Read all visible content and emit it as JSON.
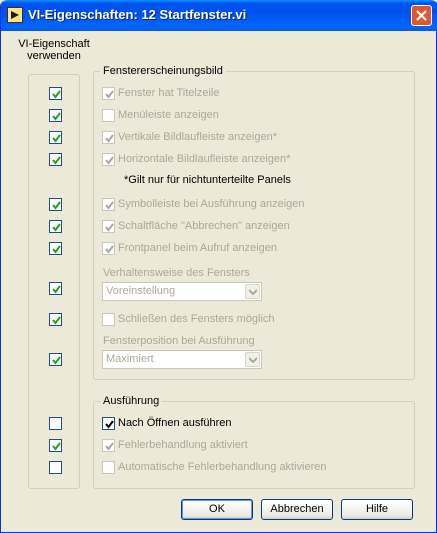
{
  "window": {
    "title": "VI-Eigenschaften: 12 Startfenster.vi"
  },
  "left_panel": {
    "header": "VI-Eigenschaft verwenden"
  },
  "appearance": {
    "group_label": "Fenstererscheinungsbild",
    "rows": [
      {
        "label": "Fenster hat Titelzeile",
        "use": true,
        "checked": true,
        "enabled": false
      },
      {
        "label": "Menüleiste anzeigen",
        "use": true,
        "checked": false,
        "enabled": false
      },
      {
        "label": "Vertikale Bildlaufleiste anzeigen*",
        "use": true,
        "checked": true,
        "enabled": false
      },
      {
        "label": "Horizontale Bildlaufleiste anzeigen*",
        "use": true,
        "checked": true,
        "enabled": false
      },
      {
        "label": "Symbolleiste bei Ausführung anzeigen",
        "use": true,
        "checked": true,
        "enabled": false
      },
      {
        "label": "Schaltfläche \"Abbrechen\" anzeigen",
        "use": true,
        "checked": true,
        "enabled": false
      },
      {
        "label": "Frontpanel beim Aufruf anzeigen",
        "use": true,
        "checked": true,
        "enabled": false
      }
    ],
    "note": "*Gilt nur für nichtunterteilte Panels",
    "behavior_label": "Verhaltensweise des Fensters",
    "behavior_value": "Voreinstellung",
    "behavior_use": true,
    "close_label": "Schließen des Fensters möglich",
    "close_checked": false,
    "close_use": true,
    "position_label": "Fensterposition bei Ausführung",
    "position_value": "Maximiert",
    "position_use": true
  },
  "execution": {
    "group_label": "Ausführung",
    "rows": [
      {
        "label": "Nach Öffnen ausführen",
        "use": false,
        "checked": true,
        "enabled": true
      },
      {
        "label": "Fehlerbehandlung aktiviert",
        "use": true,
        "checked": true,
        "enabled": false
      },
      {
        "label": "Automatische Fehlerbehandlung aktivieren",
        "use": false,
        "checked": false,
        "enabled": false
      }
    ]
  },
  "buttons": {
    "ok": "OK",
    "cancel": "Abbrechen",
    "help": "Hilfe"
  },
  "icons": {
    "app": "labview-vi-icon",
    "close": "close-icon",
    "dropdown": "chevron-down-icon",
    "check": "check-icon"
  },
  "colors": {
    "titlebar": "#0053ee",
    "dialog_bg": "#ece9d8",
    "check_green": "#21a121",
    "close_red": "#e0562e"
  }
}
